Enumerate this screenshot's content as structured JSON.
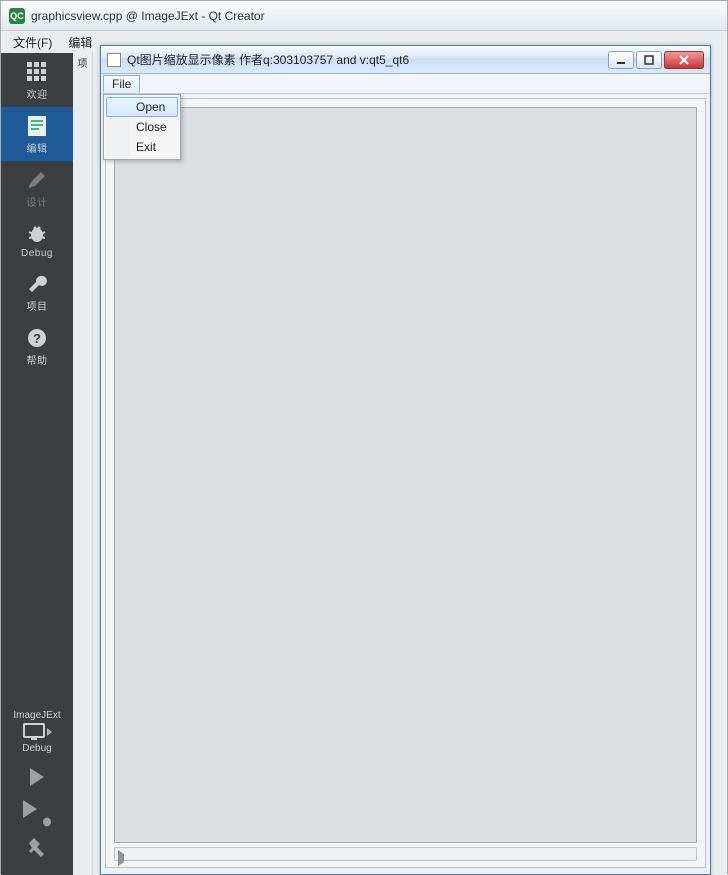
{
  "main_window": {
    "icon_text": "QC",
    "title": "graphicsview.cpp @ ImageJExt - Qt Creator",
    "menus": {
      "file": "文件(F)",
      "edit": "编辑"
    }
  },
  "sidebar": {
    "welcome": "欢迎",
    "editor": "编辑",
    "design": "设计",
    "debug": "Debug",
    "project": "项目",
    "help": "帮助"
  },
  "sidebar_bottom": {
    "kit": "ImageJExt",
    "mode": "Debug"
  },
  "content": {
    "strip_label": "项"
  },
  "child_window": {
    "title": "Qt图片缩放显示像素 作者q:303103757 and v:qt5_qt6",
    "menus": {
      "file": "File"
    },
    "dropdown": {
      "open": "Open",
      "close": "Close",
      "exit": "Exit"
    }
  }
}
